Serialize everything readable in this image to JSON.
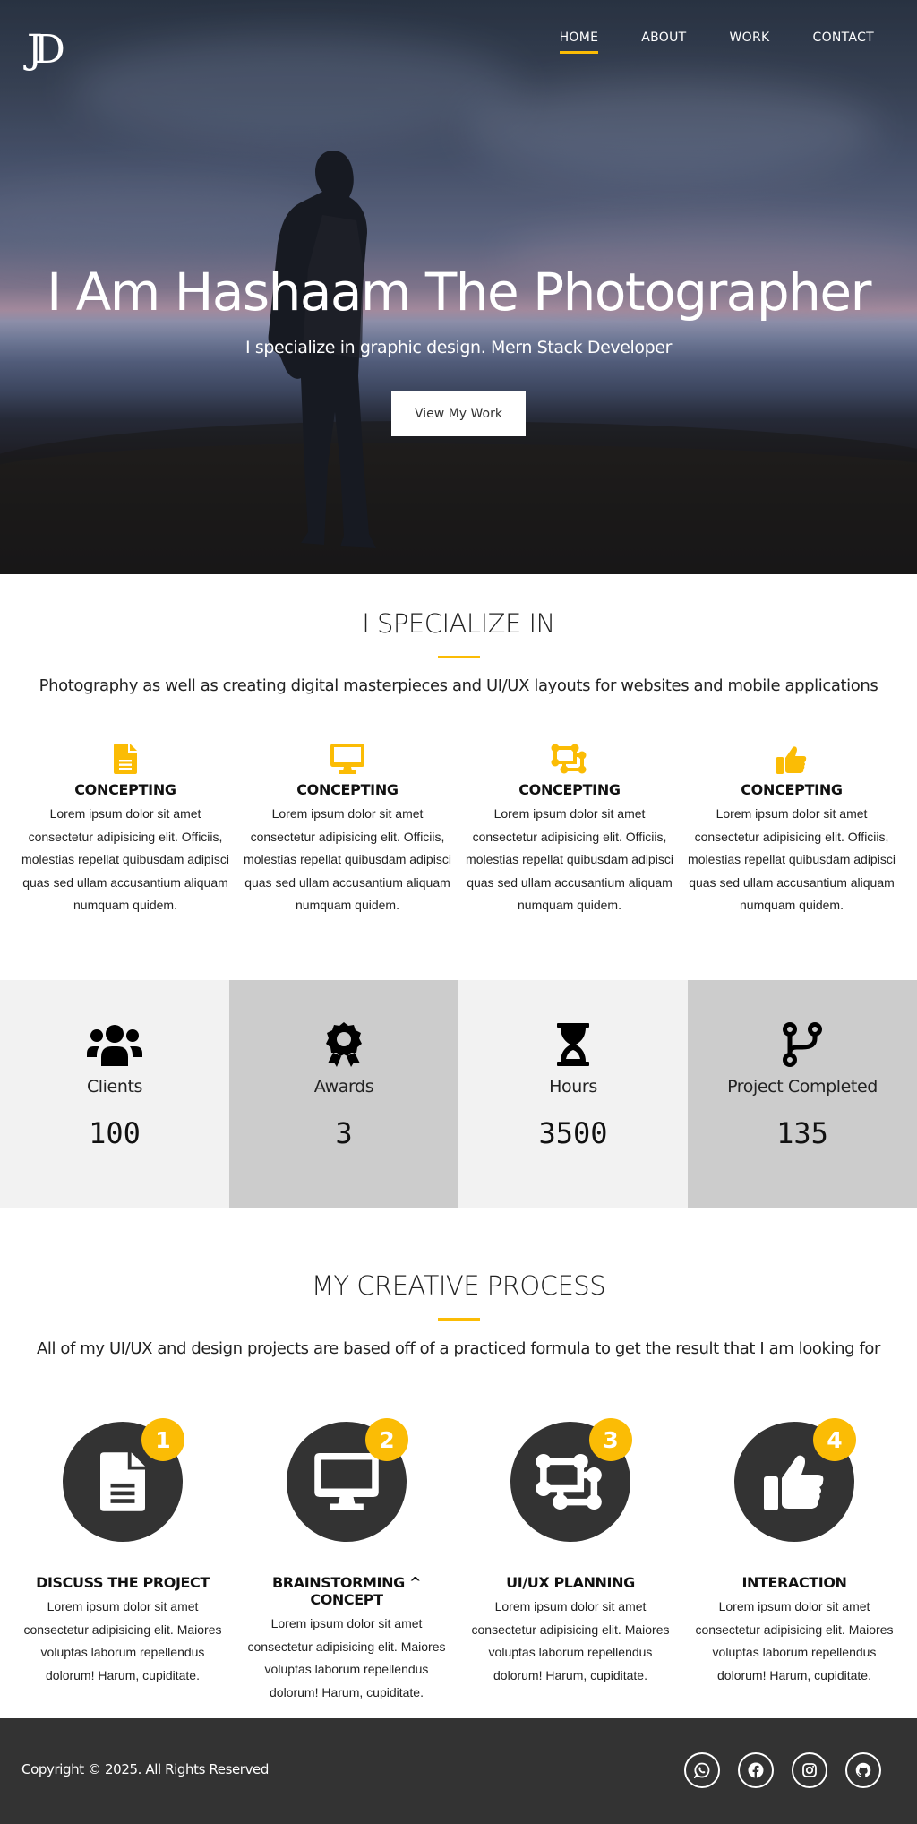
{
  "brand": {
    "logo_text": "JD"
  },
  "nav": [
    {
      "label": "HOME",
      "active": true
    },
    {
      "label": "ABOUT",
      "active": false
    },
    {
      "label": "WORK",
      "active": false
    },
    {
      "label": "CONTACT",
      "active": false
    }
  ],
  "hero": {
    "title": "I Am Hashaam The Photographer",
    "subtitle": "I specialize in graphic design. Mern Stack Developer",
    "button": "View My Work"
  },
  "specialize": {
    "title": "I SPECIALIZE IN",
    "description": "Photography as well as creating digital masterpieces and UI/UX layouts for websites and mobile applications",
    "items": [
      {
        "icon": "file-icon",
        "heading": "CONCEPTING",
        "text": "Lorem ipsum dolor sit amet consectetur adipisicing elit. Officiis, molestias repellat quibusdam adipisci quas sed ullam accusantium aliquam numquam quidem."
      },
      {
        "icon": "desktop-icon",
        "heading": "CONCEPTING",
        "text": "Lorem ipsum dolor sit amet consectetur adipisicing elit. Officiis, molestias repellat quibusdam adipisci quas sed ullam accusantium aliquam numquam quidem."
      },
      {
        "icon": "object-group-icon",
        "heading": "CONCEPTING",
        "text": "Lorem ipsum dolor sit amet consectetur adipisicing elit. Officiis, molestias repellat quibusdam adipisci quas sed ullam accusantium aliquam numquam quidem."
      },
      {
        "icon": "thumbs-up-icon",
        "heading": "CONCEPTING",
        "text": "Lorem ipsum dolor sit amet consectetur adipisicing elit. Officiis, molestias repellat quibusdam adipisci quas sed ullam accusantium aliquam numquam quidem."
      }
    ]
  },
  "stats": [
    {
      "icon": "users-icon",
      "label": "Clients",
      "value": "100"
    },
    {
      "icon": "award-icon",
      "label": "Awards",
      "value": "3"
    },
    {
      "icon": "hourglass-icon",
      "label": "Hours",
      "value": "3500"
    },
    {
      "icon": "code-branch-icon",
      "label": "Project Completed",
      "value": "135"
    }
  ],
  "process": {
    "title": "MY CREATIVE PROCESS",
    "description": "All of my UI/UX and design projects are based off of a practiced formula to get the result that I am looking for",
    "steps": [
      {
        "number": "1",
        "icon": "file-icon",
        "heading": "DISCUSS THE PROJECT",
        "text": "Lorem ipsum dolor sit amet consectetur adipisicing elit. Maiores voluptas laborum repellendus dolorum! Harum, cupiditate."
      },
      {
        "number": "2",
        "icon": "desktop-icon",
        "heading": "BRAINSTORMING ^ CONCEPT",
        "text": "Lorem ipsum dolor sit amet consectetur adipisicing elit. Maiores voluptas laborum repellendus dolorum! Harum, cupiditate."
      },
      {
        "number": "3",
        "icon": "object-group-icon",
        "heading": "UI/UX PLANNING",
        "text": "Lorem ipsum dolor sit amet consectetur adipisicing elit. Maiores voluptas laborum repellendus dolorum! Harum, cupiditate."
      },
      {
        "number": "4",
        "icon": "thumbs-up-icon",
        "heading": "INTERACTION",
        "text": "Lorem ipsum dolor sit amet consectetur adipisicing elit. Maiores voluptas laborum repellendus dolorum! Harum, cupiditate."
      }
    ]
  },
  "footer": {
    "copyright": "Copyright © 2025. All Rights Reserved",
    "socials": [
      "whatsapp-icon",
      "facebook-icon",
      "instagram-icon",
      "github-icon"
    ]
  },
  "colors": {
    "accent": "#fbbc05",
    "dark": "#333333",
    "stat_light": "#f2f2f2",
    "stat_dark": "#cccccc"
  }
}
